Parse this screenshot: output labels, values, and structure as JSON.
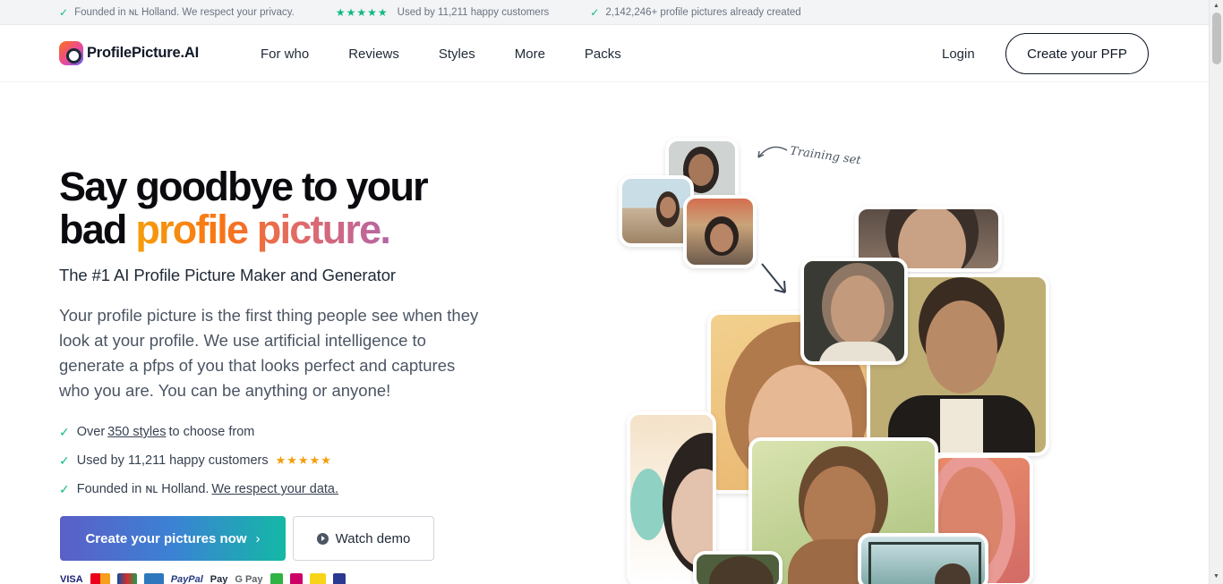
{
  "topbar": {
    "founded": "Founded in ɴʟ Holland. We respect your privacy.",
    "stars": "★★★★★",
    "used_by": "Used by 11,211 happy customers",
    "created": "2,142,246+ profile pictures already created"
  },
  "header": {
    "logo_text": "ProfilePicture.AI",
    "nav": [
      "For who",
      "Reviews",
      "Styles",
      "More",
      "Packs"
    ],
    "login": "Login",
    "cta": "Create your PFP"
  },
  "hero": {
    "headline_line1": "Say goodbye to your",
    "headline_bad": "bad ",
    "headline_grad": "profile picture.",
    "subtitle": "The #1 AI Profile Picture Maker and Generator",
    "paragraph": "Your profile picture is the first thing people see when they look at your profile. We use artificial intelligence to generate a pfps of you that looks perfect and captures who you are. You can be anything or anyone!",
    "bullets": {
      "b1_pre": "Over",
      "b1_link": "350 styles",
      "b1_post": "to choose from",
      "b2_text": "Used by 11,211 happy customers",
      "b2_stars": "★★★★★",
      "b3_pre": "Founded in ɴʟ Holland.",
      "b3_link": "We respect your data."
    },
    "btn_main": "Create your pictures now",
    "btn_main_arrow": "›",
    "btn_demo": "Watch demo"
  },
  "payments": [
    "VISA",
    "PayPal",
    "Pay",
    "G Pay"
  ],
  "collage": {
    "training_label": "Training set"
  },
  "colors": {
    "accent_green": "#10b981",
    "star_gold": "#f59e0b",
    "btn_gradient_start": "#5b5fc7",
    "btn_gradient_end": "#14b8a6"
  }
}
